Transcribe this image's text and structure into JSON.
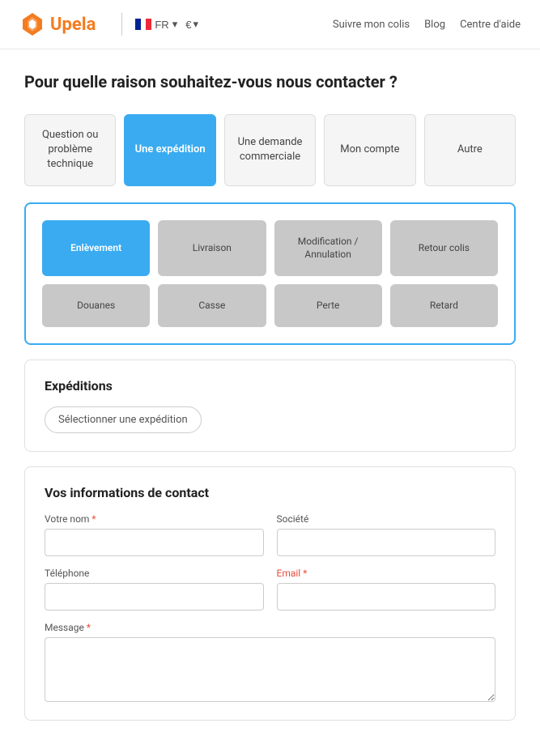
{
  "header": {
    "logo_text": "Upela",
    "lang_label": "FR",
    "currency_label": "€",
    "nav_items": [
      {
        "label": "Suivre mon colis",
        "href": "#"
      },
      {
        "label": "Blog",
        "href": "#"
      },
      {
        "label": "Centre d'aide",
        "href": "#"
      }
    ]
  },
  "page": {
    "title": "Pour quelle raison souhaitez-vous nous contacter ?"
  },
  "categories": [
    {
      "id": "technique",
      "label": "Question ou problème technique",
      "active": false
    },
    {
      "id": "expedition",
      "label": "Une expédition",
      "active": true
    },
    {
      "id": "demande",
      "label": "Une demande commerciale",
      "active": false
    },
    {
      "id": "compte",
      "label": "Mon compte",
      "active": false
    },
    {
      "id": "autre",
      "label": "Autre",
      "active": false
    }
  ],
  "subcategories": [
    {
      "id": "enlevement",
      "label": "Enlèvement",
      "active": true
    },
    {
      "id": "livraison",
      "label": "Livraison",
      "active": false
    },
    {
      "id": "modification",
      "label": "Modification / Annulation",
      "active": false
    },
    {
      "id": "retour",
      "label": "Retour colis",
      "active": false
    },
    {
      "id": "douanes",
      "label": "Douanes",
      "active": false
    },
    {
      "id": "casse",
      "label": "Casse",
      "active": false
    },
    {
      "id": "perte",
      "label": "Perte",
      "active": false
    },
    {
      "id": "retard",
      "label": "Retard",
      "active": false
    }
  ],
  "expeditions_section": {
    "title": "Expéditions",
    "select_btn_label": "Sélectionner une expédition"
  },
  "contact_section": {
    "title": "Vos informations de contact",
    "fields": {
      "nom_label": "Votre nom",
      "nom_placeholder": "",
      "societe_label": "Société",
      "societe_placeholder": "",
      "telephone_label": "Téléphone",
      "telephone_placeholder": "",
      "email_label": "Email",
      "email_placeholder": "",
      "message_label": "Message",
      "message_placeholder": ""
    }
  }
}
